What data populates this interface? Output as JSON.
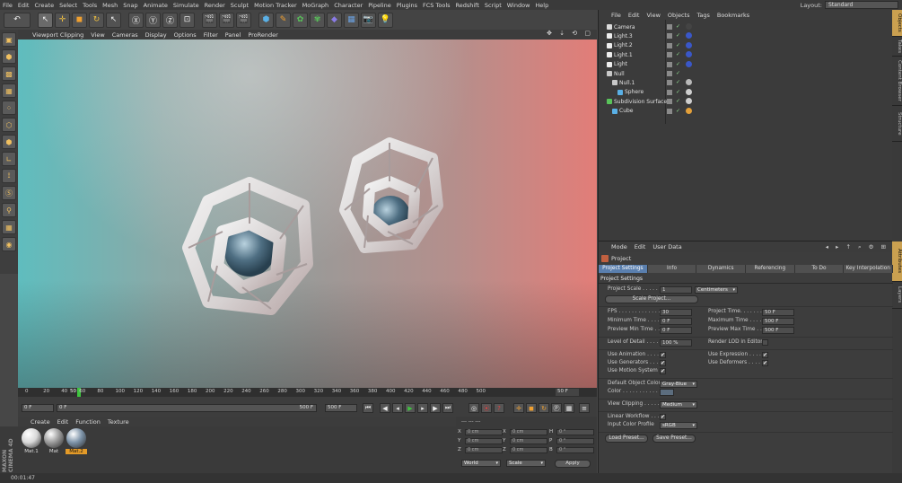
{
  "menubar": {
    "items": [
      "File",
      "Edit",
      "Create",
      "Select",
      "Tools",
      "Mesh",
      "Snap",
      "Animate",
      "Simulate",
      "Render",
      "Sculpt",
      "Motion Tracker",
      "MoGraph",
      "Character",
      "Pipeline",
      "Plugins",
      "FCS Tools",
      "Redshift",
      "Script",
      "Window",
      "Help"
    ],
    "layout_label": "Layout:",
    "layout_value": "Standard"
  },
  "viewport": {
    "menu": [
      "Viewport Clipping",
      "View",
      "Cameras",
      "Display",
      "Options",
      "Filter",
      "Panel",
      "ProRender"
    ],
    "nav_icons": "✥ ⇣ ⟲ ▢"
  },
  "timeline": {
    "ticks": [
      "0",
      "20",
      "40",
      "60",
      "80",
      "100",
      "120",
      "140",
      "160",
      "180",
      "200",
      "220",
      "240",
      "260",
      "280",
      "300",
      "320",
      "340",
      "360",
      "380",
      "400",
      "420",
      "440",
      "460",
      "480",
      "500"
    ],
    "current_frame": "50",
    "end_frame_label": "50 F",
    "start_field": "0 F",
    "min_field": "0 F",
    "max_field": "500 F",
    "end_field": "500 F"
  },
  "material_manager": {
    "menu": [
      "Create",
      "Edit",
      "Function",
      "Texture"
    ],
    "materials": [
      {
        "name": "Mat.1",
        "color": "#d8d8d8"
      },
      {
        "name": "Mat",
        "color": "#9a9a9a"
      },
      {
        "name": "Mat.2",
        "color": "#7d93a8"
      }
    ],
    "brand": "MAXON CINEMA 4D"
  },
  "coords": {
    "header": "--- --- ---",
    "rows": [
      {
        "a": "X",
        "av": "0 cm",
        "b": "X",
        "bv": "0 cm",
        "c": "H",
        "cv": "0 °"
      },
      {
        "a": "Y",
        "av": "0 cm",
        "b": "Y",
        "bv": "0 cm",
        "c": "P",
        "cv": "0 °"
      },
      {
        "a": "Z",
        "av": "0 cm",
        "b": "Z",
        "bv": "0 cm",
        "c": "B",
        "cv": "0 °"
      }
    ],
    "mode1": "World",
    "mode2": "Scale",
    "apply": "Apply"
  },
  "status": {
    "time": "00:01:47"
  },
  "object_manager": {
    "menu": [
      "File",
      "Edit",
      "View",
      "Objects",
      "Tags",
      "Bookmarks"
    ],
    "objects": [
      {
        "name": "Camera",
        "indent": 0,
        "icon_color": "#dcdcdc",
        "tag": "#444"
      },
      {
        "name": "Light.3",
        "indent": 0,
        "icon_color": "#eeeeee",
        "tag": "#3a57c8"
      },
      {
        "name": "Light.2",
        "indent": 0,
        "icon_color": "#eeeeee",
        "tag": "#3a57c8"
      },
      {
        "name": "Light.1",
        "indent": 0,
        "icon_color": "#eeeeee",
        "tag": "#3a57c8"
      },
      {
        "name": "Light",
        "indent": 0,
        "icon_color": "#eeeeee",
        "tag": "#3a57c8"
      },
      {
        "name": "Null",
        "indent": 0,
        "icon_color": "#c8c8c8",
        "tag": ""
      },
      {
        "name": "Null.1",
        "indent": 1,
        "icon_color": "#c8c8c8",
        "tag": "#b9b9b9"
      },
      {
        "name": "Sphere",
        "indent": 2,
        "icon_color": "#5ab0e6",
        "tag": "#cfcfcf"
      },
      {
        "name": "Subdivision Surface",
        "indent": 0,
        "icon_color": "#59c35a",
        "tag": "#cfcfcf"
      },
      {
        "name": "Cube",
        "indent": 1,
        "icon_color": "#5ab0e6",
        "tag": "#e3a03a"
      }
    ]
  },
  "side_tabs": [
    "Objects",
    "Takes",
    "Content Browser",
    "Structure",
    "Attributes",
    "Layers"
  ],
  "attributes": {
    "menu": [
      "Mode",
      "Edit",
      "User Data"
    ],
    "icons": "◂ ▸ ↑ ⌕ ⚙ ⊞",
    "title": "Project",
    "tabs": [
      "Project Settings",
      "Info",
      "Dynamics",
      "Referencing",
      "To Do",
      "Key Interpolation"
    ],
    "section": "Project Settings",
    "project_scale_label": "Project Scale . . . . . .",
    "project_scale_value": "1",
    "project_scale_unit": "Centimeters",
    "scale_project_btn": "Scale Project...",
    "fps_label": "FPS . . . . . . . . . . . . . .",
    "fps_value": "30",
    "project_time_label": "Project Time. . . . . . .",
    "project_time_value": "50 F",
    "min_time_label": "Minimum Time . . . . .",
    "min_time_value": "0 F",
    "max_time_label": "Maximum Time . . . .",
    "max_time_value": "500 F",
    "preview_min_label": "Preview Min Time . .",
    "preview_min_value": "0 F",
    "preview_max_label": "Preview Max Time . .",
    "preview_max_value": "500 F",
    "lod_label": "Level of Detail . . . . .",
    "lod_value": "100 %",
    "render_lod_label": "Render LOD in Editor",
    "use_animation_label": "Use Animation . . . . .",
    "use_expression_label": "Use Expression . . . .",
    "use_generators_label": "Use Generators . . . .",
    "use_deformers_label": "Use Deformers . . . .",
    "use_motion_label": "Use Motion System",
    "check": "✔",
    "default_color_label": "Default Object Color",
    "default_color_value": "Gray-Blue",
    "color_label": "Color . . . . . . . . . . .",
    "color_swatch": "#5c6d7e",
    "view_clip_label": "View Clipping . . . . .",
    "view_clip_value": "Medium",
    "linear_wf_label": "Linear Workflow . . .",
    "input_profile_label": "Input Color Profile",
    "input_profile_value": "sRGB",
    "load_preset_btn": "Load Preset...",
    "save_preset_btn": "Save Preset..."
  }
}
